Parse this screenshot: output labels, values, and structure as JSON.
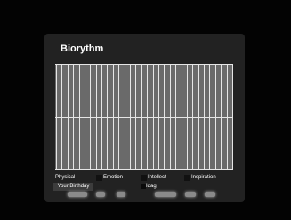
{
  "window": {
    "title": "Biorythm"
  },
  "legend": [
    {
      "label": "Physical"
    },
    {
      "label": "Emotion"
    },
    {
      "label": "Intellect"
    },
    {
      "label": "Inspiration"
    }
  ],
  "controls": {
    "birthday_label": "Your Birthday",
    "today_label": "Idag"
  },
  "colors": {
    "panel": "#222222",
    "graph": "#6a6a6a",
    "gridline": "#e6e6e6"
  }
}
